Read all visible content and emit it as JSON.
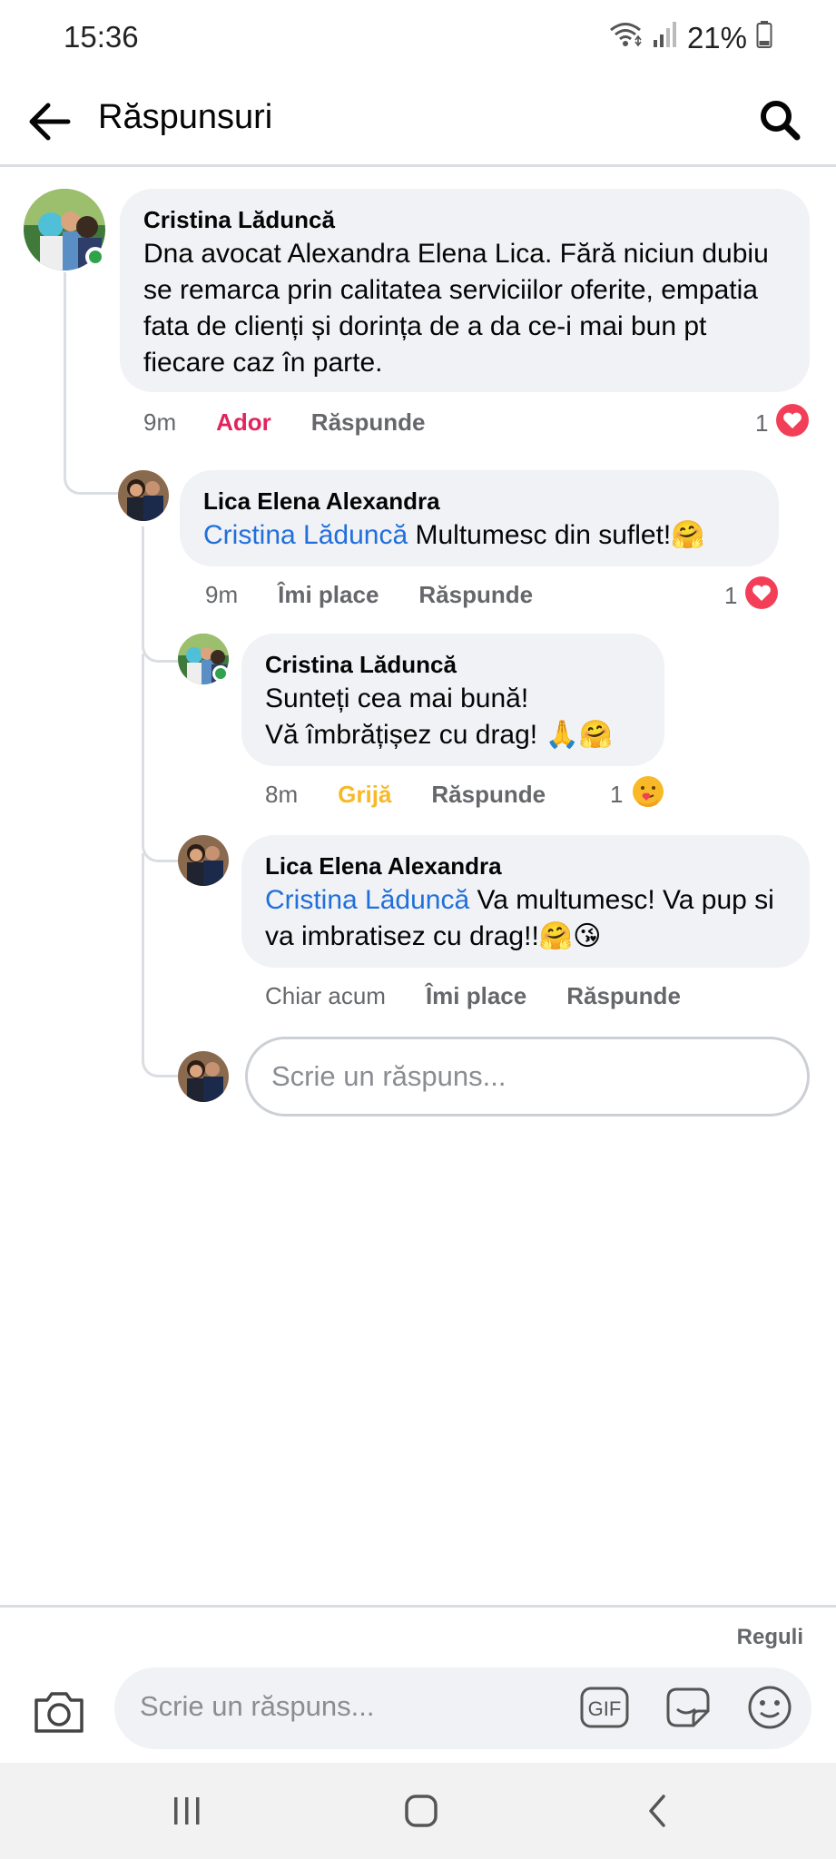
{
  "status_bar": {
    "time": "15:36",
    "battery": "21%",
    "icons": [
      "wifi-icon",
      "signal-icon",
      "battery-icon"
    ]
  },
  "header": {
    "title": "Răspunsuri",
    "back_icon": "arrow-left-icon",
    "search_icon": "search-icon"
  },
  "comments": [
    {
      "author": "Cristina Lăduncă",
      "mention": "",
      "text": "Dna avocat Alexandra Elena Lica. Fără niciun dubiu se remarca prin calitatea serviciilor oferite, empatia fata de clienți și dorința de a da ce-i mai bun pt fiecare caz în parte.",
      "time": "9m",
      "reaction_label": "Ador",
      "reaction_color": "#e0245e",
      "reply_label": "Răspunde",
      "reaction_count": "1",
      "reaction_icon": "heart-icon",
      "online": true
    },
    {
      "author": "Lica Elena Alexandra",
      "mention": "Cristina Lăduncă",
      "text": "Multumesc din suflet!🤗",
      "time": "9m",
      "reaction_label": "Îmi place",
      "reaction_color": "#65676b",
      "reply_label": "Răspunde",
      "reaction_count": "1",
      "reaction_icon": "heart-icon",
      "online": false
    },
    {
      "author": "Cristina Lăduncă",
      "mention": "",
      "text_line1": "Sunteți cea mai bună!",
      "text_line2": "Vă îmbrățișez cu drag! 🙏🤗",
      "time": "8m",
      "reaction_label": "Grijă",
      "reaction_color": "#f7b928",
      "reply_label": "Răspunde",
      "reaction_count": "1",
      "reaction_icon": "care-emoji-icon",
      "online": true
    },
    {
      "author": "Lica Elena Alexandra",
      "mention": "Cristina Lăduncă",
      "text": "Va multumesc! Va pup si va imbratisez cu drag!!🤗😘",
      "time": "Chiar acum",
      "reaction_label": "Îmi place",
      "reaction_color": "#65676b",
      "reply_label": "Răspunde",
      "online": false
    }
  ],
  "inline_reply": {
    "placeholder": "Scrie un răspuns..."
  },
  "footer": {
    "rules": "Reguli",
    "composer_placeholder": "Scrie un răspuns...",
    "icons": [
      "camera-icon",
      "gif-icon",
      "sticker-icon",
      "emoji-icon"
    ]
  },
  "nav_bar": {
    "icons": [
      "recent-apps-icon",
      "home-icon",
      "back-nav-icon"
    ]
  },
  "colors": {
    "bubble": "#f0f2f5",
    "mention": "#216fdb",
    "heart": "#f33e58",
    "online": "#31a24c"
  }
}
